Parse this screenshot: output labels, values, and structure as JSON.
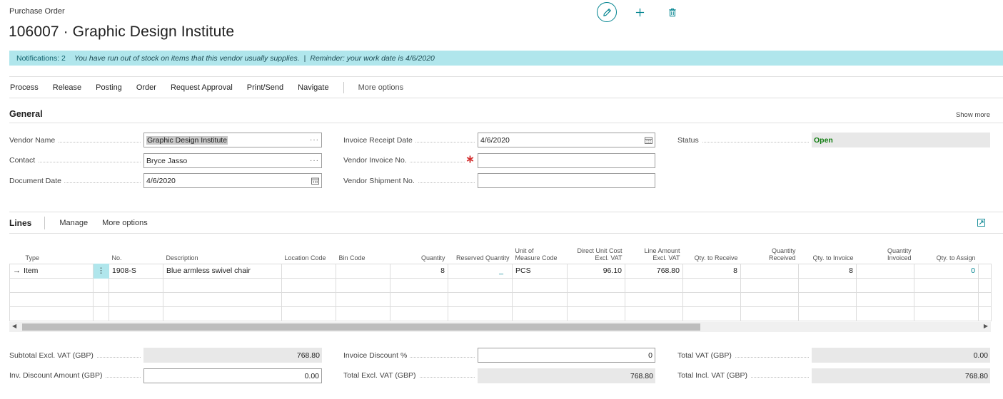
{
  "header": {
    "caption": "Purchase Order",
    "title": "106007 · Graphic Design Institute"
  },
  "icons": {
    "edit": "pencil-icon",
    "new": "plus-icon",
    "delete": "trash-icon",
    "expand": "expand-icon"
  },
  "notification": {
    "count": "Notifications: 2",
    "message1": "You have run out of stock on items that this vendor usually supplies.",
    "separator": "|",
    "message2": "Reminder: your work date is 4/6/2020"
  },
  "menu": {
    "items": [
      "Process",
      "Release",
      "Posting",
      "Order",
      "Request Approval",
      "Print/Send",
      "Navigate"
    ],
    "more": "More options"
  },
  "general": {
    "title": "General",
    "show_more": "Show more",
    "vendor_name_label": "Vendor Name",
    "vendor_name_value": "Graphic Design Institute",
    "contact_label": "Contact",
    "contact_value": "Bryce Jasso",
    "document_date_label": "Document Date",
    "document_date_value": "4/6/2020",
    "invoice_receipt_date_label": "Invoice Receipt Date",
    "invoice_receipt_date_value": "4/6/2020",
    "vendor_invoice_no_label": "Vendor Invoice No.",
    "vendor_invoice_no_value": "",
    "vendor_shipment_no_label": "Vendor Shipment No.",
    "vendor_shipment_no_value": "",
    "status_label": "Status",
    "status_value": "Open",
    "ellipsis": "···"
  },
  "lines": {
    "title": "Lines",
    "manage": "Manage",
    "more": "More options",
    "columns": {
      "type": "Type",
      "no": "No.",
      "description": "Description",
      "location_code": "Location Code",
      "bin_code": "Bin Code",
      "quantity": "Quantity",
      "reserved_quantity": "Reserved Quantity",
      "uom_1": "Unit of",
      "uom_2": "Measure Code",
      "direct_cost_1": "Direct Unit Cost",
      "direct_cost_2": "Excl. VAT",
      "line_amount_1": "Line Amount",
      "line_amount_2": "Excl. VAT",
      "qty_to_receive": "Qty. to Receive",
      "qty_received_1": "Quantity",
      "qty_received_2": "Received",
      "qty_to_invoice": "Qty. to Invoice",
      "qty_invoiced_1": "Quantity",
      "qty_invoiced_2": "Invoiced",
      "qty_to_assign": "Qty. to Assign"
    },
    "row": {
      "arrow": "→",
      "type": "Item",
      "menu": "⋮",
      "no": "1908-S",
      "description": "Blue armless swivel chair",
      "location_code": "",
      "bin_code": "",
      "quantity": "8",
      "reserved_quantity": "_",
      "uom": "PCS",
      "direct_unit_cost": "96.10",
      "line_amount": "768.80",
      "qty_to_receive": "8",
      "qty_received": "",
      "qty_to_invoice": "8",
      "qty_invoiced": "",
      "qty_to_assign": "0"
    }
  },
  "totals": {
    "subtotal_label": "Subtotal Excl. VAT (GBP)",
    "subtotal_value": "768.80",
    "inv_discount_amount_label": "Inv. Discount Amount (GBP)",
    "inv_discount_amount_value": "0.00",
    "invoice_discount_pct_label": "Invoice Discount %",
    "invoice_discount_pct_value": "0",
    "total_excl_vat_label": "Total Excl. VAT (GBP)",
    "total_excl_vat_value": "768.80",
    "total_vat_label": "Total VAT (GBP)",
    "total_vat_value": "0.00",
    "total_incl_vat_label": "Total Incl. VAT (GBP)",
    "total_incl_vat_value": "768.80"
  },
  "colors": {
    "accent": "#00838f",
    "notification_bg": "#b0e6ec",
    "status_open": "#107c10",
    "required": "#d32f2f"
  }
}
